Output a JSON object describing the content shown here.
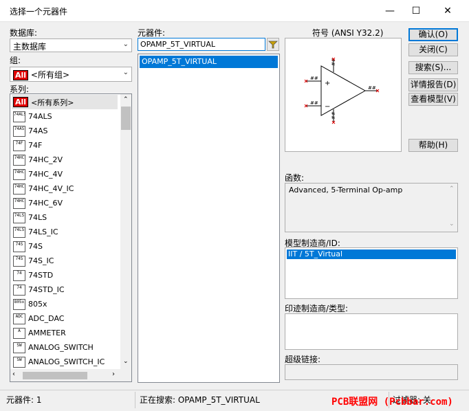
{
  "window": {
    "title": "选择一个元器件",
    "minimize": "—",
    "maximize": "☐",
    "close": "✕"
  },
  "database": {
    "label": "数据库:",
    "value": "主数据库"
  },
  "group": {
    "label": "组:",
    "icon_text": "All",
    "value": "<所有组>"
  },
  "family": {
    "label": "系列:",
    "items": [
      {
        "icon": "All",
        "label": "<所有系列>"
      },
      {
        "icon": "74ALS",
        "label": "74ALS"
      },
      {
        "icon": "74AS",
        "label": "74AS"
      },
      {
        "icon": "74F",
        "label": "74F"
      },
      {
        "icon": "74HC",
        "label": "74HC_2V"
      },
      {
        "icon": "74HC",
        "label": "74HC_4V"
      },
      {
        "icon": "74HC",
        "label": "74HC_4V_IC"
      },
      {
        "icon": "74HC",
        "label": "74HC_6V"
      },
      {
        "icon": "74LS",
        "label": "74LS"
      },
      {
        "icon": "74LS",
        "label": "74LS_IC"
      },
      {
        "icon": "74S",
        "label": "74S"
      },
      {
        "icon": "74S",
        "label": "74S_IC"
      },
      {
        "icon": "74",
        "label": "74STD"
      },
      {
        "icon": "74",
        "label": "74STD_IC"
      },
      {
        "icon": "805x",
        "label": "805x"
      },
      {
        "icon": "ADC",
        "label": "ADC_DAC"
      },
      {
        "icon": "A",
        "label": "AMMETER"
      },
      {
        "icon": "SW",
        "label": "ANALOG_SWITCH"
      },
      {
        "icon": "SW",
        "label": "ANALOG_SWITCH_IC"
      }
    ]
  },
  "component": {
    "label": "元器件:",
    "search_value": "OPAMP_5T_VIRTUAL",
    "filter_icon": "filter-icon",
    "items": [
      "OPAMP_5T_VIRTUAL"
    ]
  },
  "symbol": {
    "label": "符号 (ANSI Y32.2)"
  },
  "buttons": {
    "ok": "确认(O)",
    "close": "关闭(C)",
    "search": "搜索(S)...",
    "report": "详情报告(D)",
    "view_model": "查看模型(V)",
    "help": "帮助(H)"
  },
  "function": {
    "label": "函数:",
    "value": "Advanced, 5-Terminal Op-amp"
  },
  "model_manufacturer": {
    "label": "模型制造商/ID:",
    "items": [
      "IIT / 5T_Virtual"
    ]
  },
  "footprint_manufacturer": {
    "label": "印迹制造商/类型:"
  },
  "hyperlink": {
    "label": "超级链接:"
  },
  "status": {
    "components": "元器件: 1",
    "searching": "正在搜索: OPAMP_5T_VIRTUAL",
    "filter": "过滤器: 关"
  },
  "watermark": "PCB联盟网 (Pcbbar.com)",
  "colors": {
    "accent": "#0078d7",
    "watermark": "#ff0000",
    "all_icon": "#e00000"
  }
}
